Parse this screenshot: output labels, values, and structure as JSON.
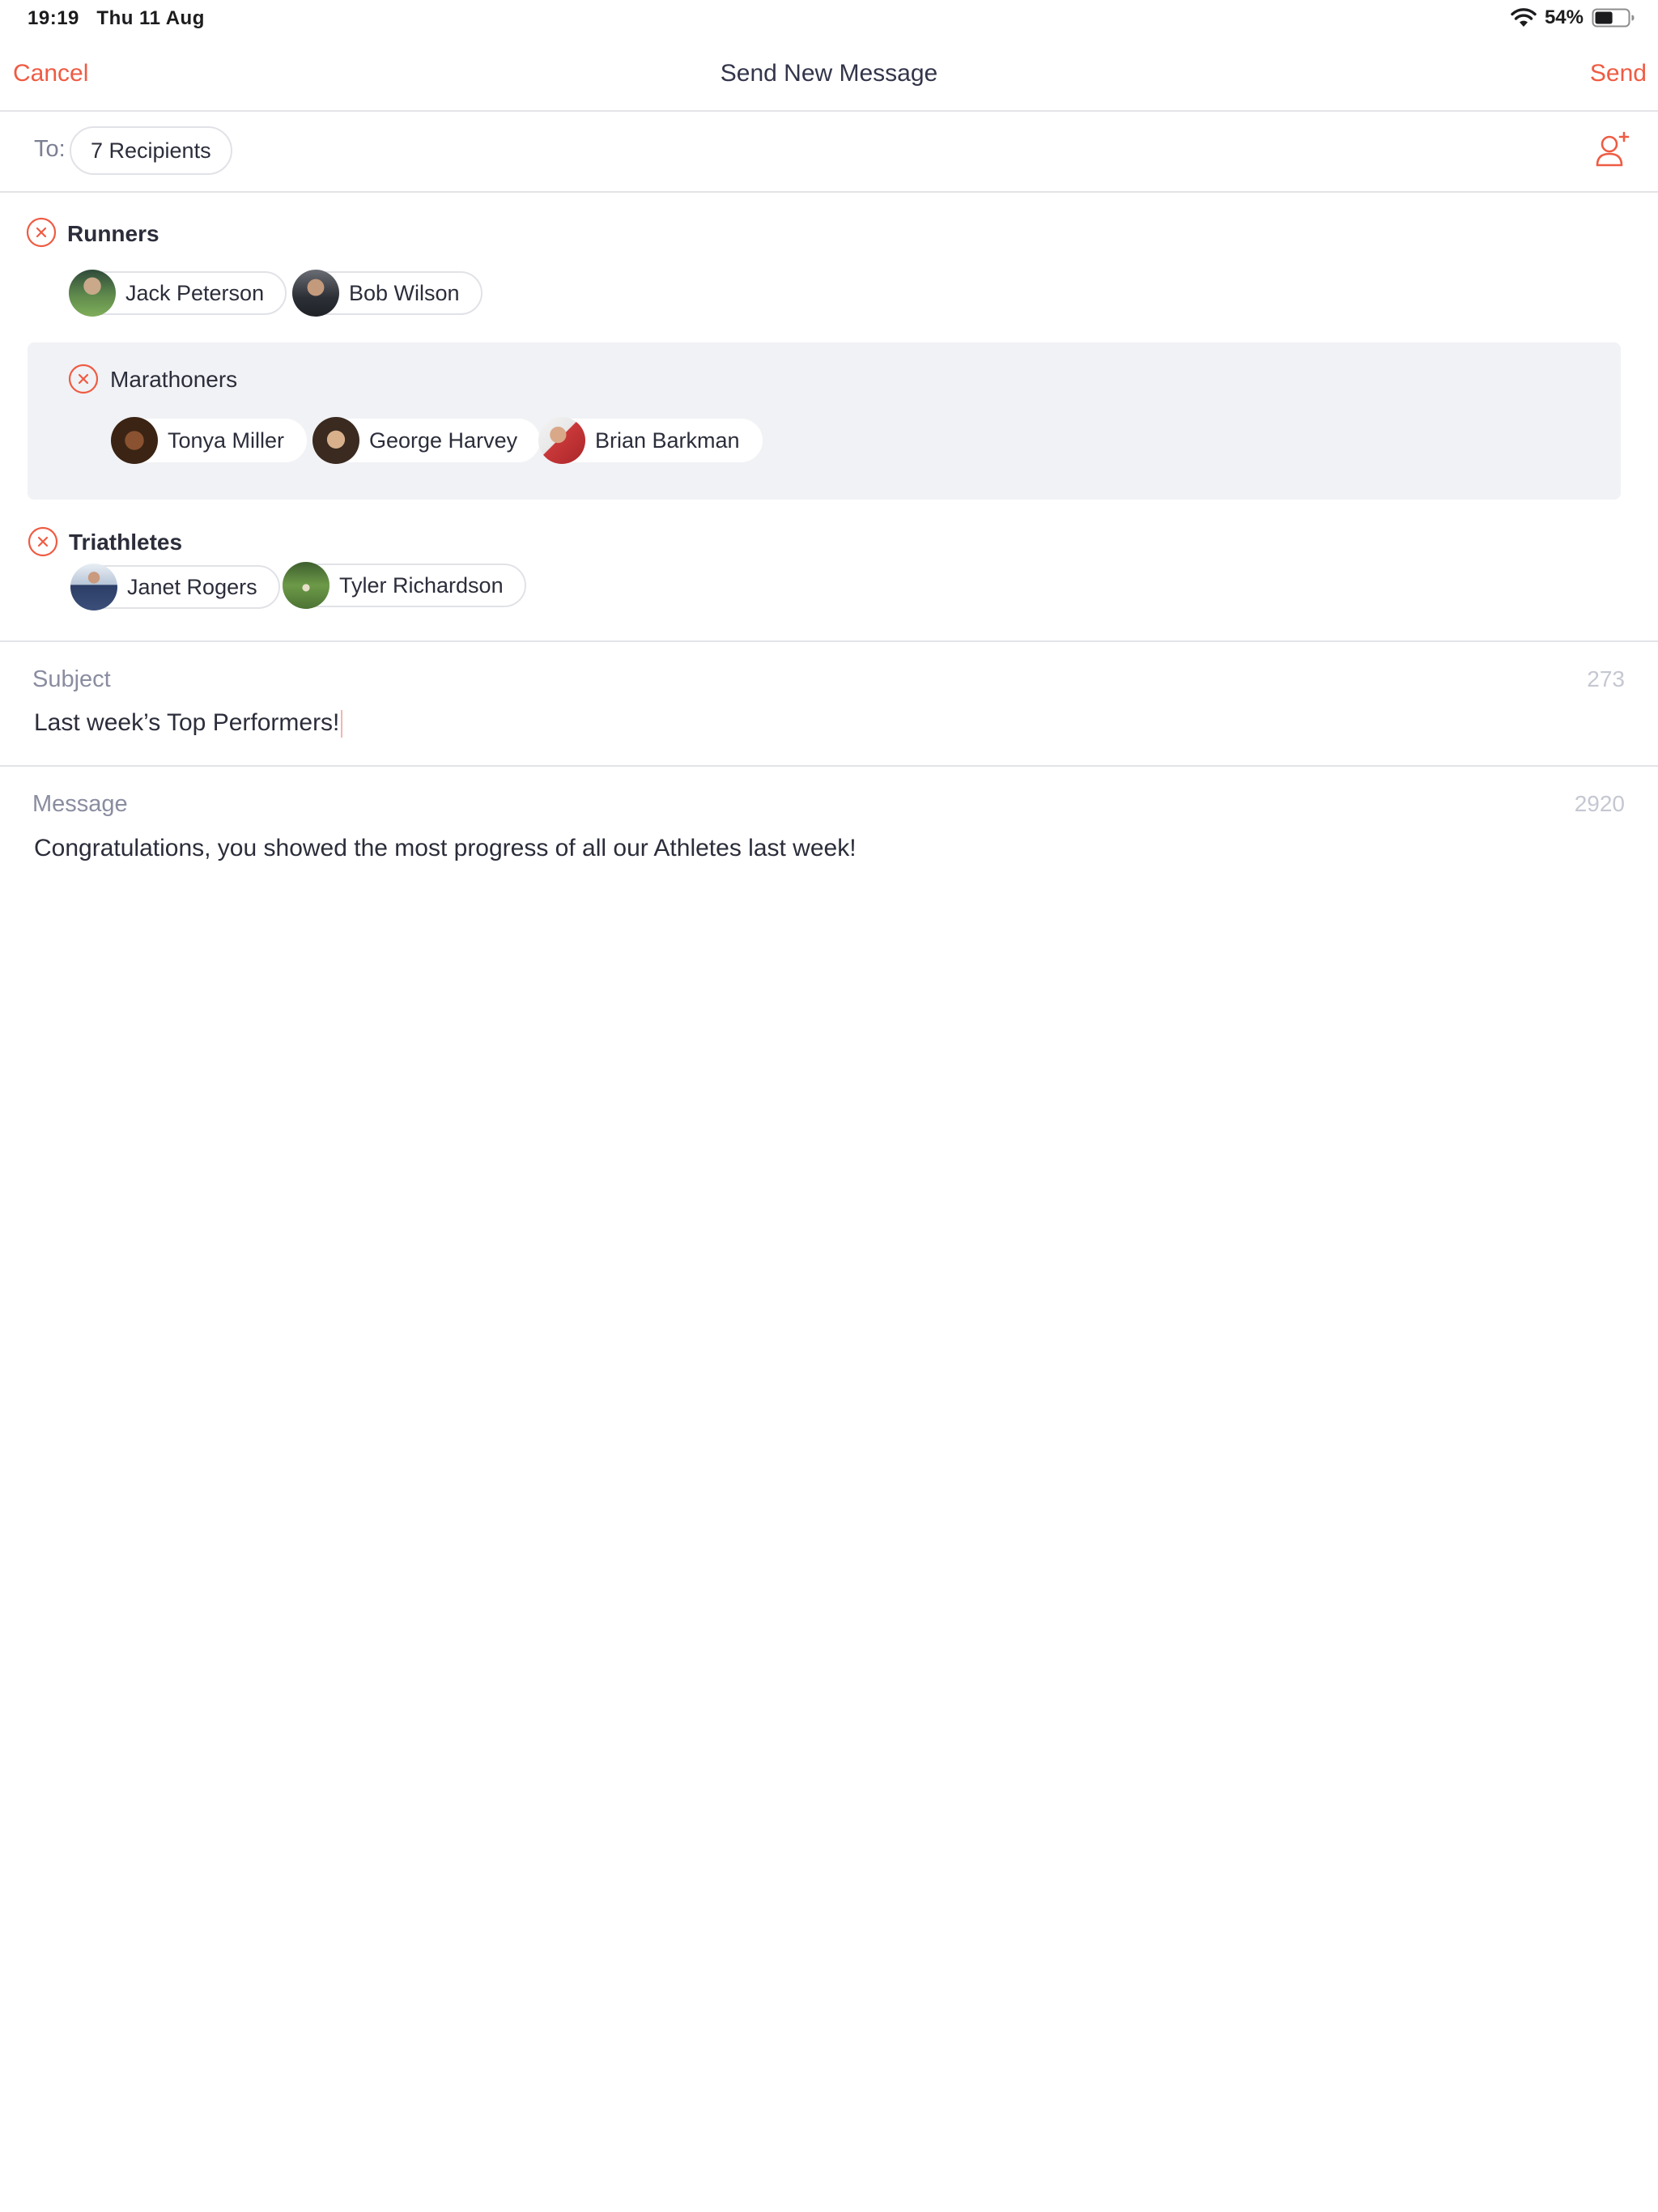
{
  "status_bar": {
    "time": "19:19",
    "date": "Thu 11 Aug",
    "battery_percent": "54%",
    "battery_level": 0.54
  },
  "nav": {
    "cancel_label": "Cancel",
    "title": "Send New Message",
    "send_label": "Send"
  },
  "to": {
    "label": "To:",
    "recipients_label": "7 Recipients",
    "add_icon": "add-person-icon"
  },
  "groups": [
    {
      "name": "Runners",
      "members": [
        {
          "name": "Jack Peterson",
          "avatar_color": "#4a6b3e"
        },
        {
          "name": "Bob Wilson",
          "avatar_color": "#3a3d45"
        }
      ]
    },
    {
      "name": "Marathoners",
      "members": [
        {
          "name": "Tonya Miller",
          "avatar_color": "#6b3f24"
        },
        {
          "name": "George Harvey",
          "avatar_color": "#5b4636"
        },
        {
          "name": "Brian Barkman",
          "avatar_color": "#c9383a"
        }
      ]
    },
    {
      "name": "Triathletes",
      "members": [
        {
          "name": "Janet Rogers",
          "avatar_color": "#8a9bb5"
        },
        {
          "name": "Tyler Richardson",
          "avatar_color": "#5f7d47"
        }
      ]
    }
  ],
  "subject": {
    "label": "Subject",
    "count": "273",
    "value": "Last week’s Top Performers!"
  },
  "message": {
    "label": "Message",
    "count": "2920",
    "value": "Congratulations, you showed the most progress of all our Athletes last week!"
  },
  "colors": {
    "accent": "#ef5b43",
    "divider": "#e3e4e8",
    "group_highlight": "#f1f2f5"
  }
}
